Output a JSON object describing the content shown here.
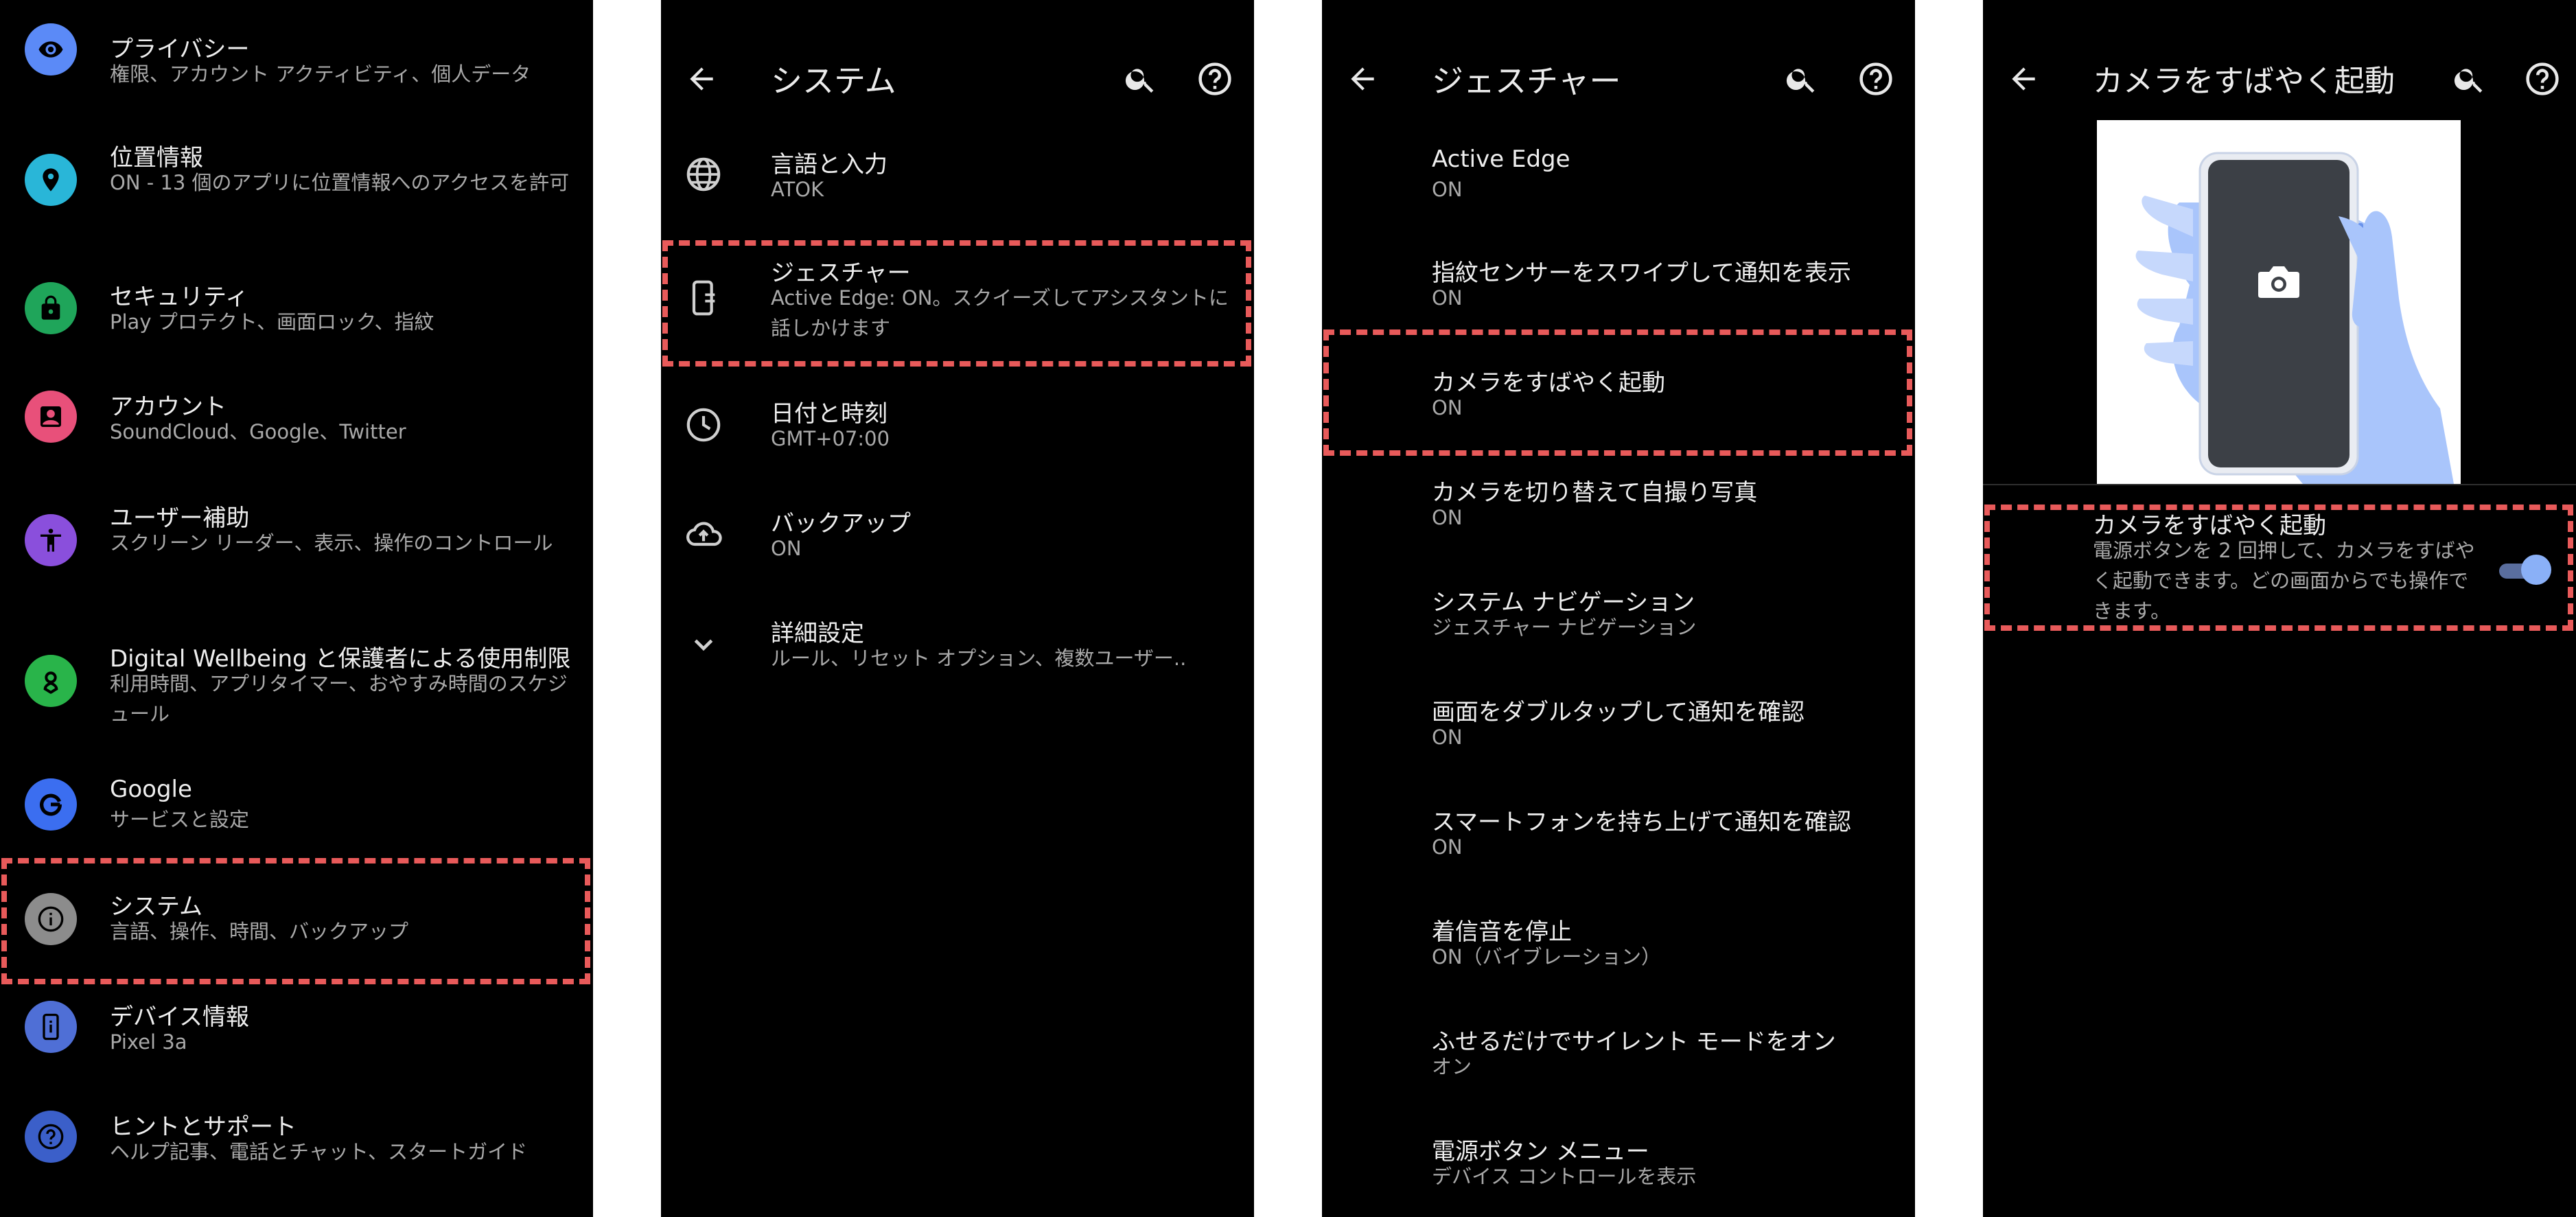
{
  "colors": {
    "background": "#000000",
    "highlight": "#e85a5a",
    "toggle_on": "#8ab0f7"
  },
  "panel1": {
    "items": [
      {
        "title": "プライバシー",
        "subtitle": "権限、アカウント アクティビティ、個人データ",
        "icon": "eye-icon",
        "color": "#5b8af7"
      },
      {
        "title": "位置情報",
        "subtitle": "ON - 13 個のアプリに位置情報へのアクセスを許可",
        "icon": "location-pin-icon",
        "color": "#29b6d8"
      },
      {
        "title": "セキュリティ",
        "subtitle": "Play プロテクト、画面ロック、指紋",
        "icon": "lock-icon",
        "color": "#1fa55a"
      },
      {
        "title": "アカウント",
        "subtitle": "SoundCloud、Google、Twitter",
        "icon": "account-box-icon",
        "color": "#e8507a"
      },
      {
        "title": "ユーザー補助",
        "subtitle": "スクリーン リーダー、表示、操作のコントロール",
        "icon": "accessibility-icon",
        "color": "#8a4fdc"
      },
      {
        "title": "Digital Wellbeing と保護者による使用制限",
        "subtitle": "利用時間、アプリタイマー、おやすみ時間のスケジュール",
        "icon": "wellbeing-icon",
        "color": "#29b44a"
      },
      {
        "title": "Google",
        "subtitle": "サービスと設定",
        "icon": "google-g-icon",
        "color": "#3b6ef0"
      },
      {
        "title": "システム",
        "subtitle": "言語、操作、時間、バックアップ",
        "icon": "info-icon",
        "color": "#8c8c8c"
      },
      {
        "title": "デバイス情報",
        "subtitle": "Pixel 3a",
        "icon": "phone-info-icon",
        "color": "#4f6fd6"
      },
      {
        "title": "ヒントとサポート",
        "subtitle": "ヘルプ記事、電話とチャット、スタートガイド",
        "icon": "help-icon",
        "color": "#3b5fc9"
      }
    ]
  },
  "panel2": {
    "title": "システム",
    "items": [
      {
        "title": "言語と入力",
        "subtitle": "ATOK",
        "icon": "globe-icon"
      },
      {
        "title": "ジェスチャー",
        "subtitle": "Active Edge: ON。スクイーズしてアシスタントに話しかけます",
        "icon": "gesture-phone-icon"
      },
      {
        "title": "日付と時刻",
        "subtitle": "GMT+07:00",
        "icon": "clock-icon"
      },
      {
        "title": "バックアップ",
        "subtitle": "ON",
        "icon": "cloud-upload-icon"
      },
      {
        "title": "詳細設定",
        "subtitle": "ルール、リセット オプション、複数ユーザー..",
        "icon": "chevron-down-icon"
      }
    ]
  },
  "panel3": {
    "title": "ジェスチャー",
    "items": [
      {
        "title": "Active Edge",
        "subtitle": "ON"
      },
      {
        "title": "指紋センサーをスワイプして通知を表示",
        "subtitle": "ON"
      },
      {
        "title": "カメラをすばやく起動",
        "subtitle": "ON"
      },
      {
        "title": "カメラを切り替えて自撮り写真",
        "subtitle": "ON"
      },
      {
        "title": "システム ナビゲーション",
        "subtitle": "ジェスチャー ナビゲーション"
      },
      {
        "title": "画面をダブルタップして通知を確認",
        "subtitle": "ON"
      },
      {
        "title": "スマートフォンを持ち上げて通知を確認",
        "subtitle": "ON"
      },
      {
        "title": "着信音を停止",
        "subtitle": "ON（バイブレーション）"
      },
      {
        "title": "ふせるだけでサイレント モードをオン",
        "subtitle": "オン"
      },
      {
        "title": "電源ボタン メニュー",
        "subtitle": "デバイス コントロールを表示"
      }
    ]
  },
  "panel4": {
    "title": "カメラをすばやく起動",
    "setting": {
      "title": "カメラをすばやく起動",
      "subtitle": "電源ボタンを 2 回押して、カメラをすばやく起動できます。どの画面からでも操作できます。",
      "enabled": true
    }
  }
}
